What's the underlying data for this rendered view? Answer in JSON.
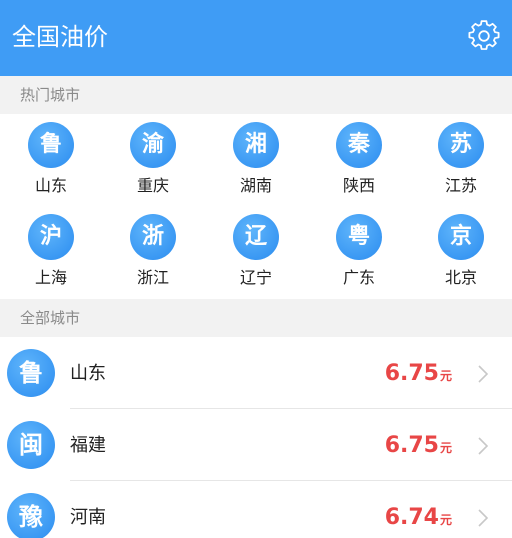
{
  "header": {
    "title": "全国油价",
    "settings_icon": "gear-icon"
  },
  "hot": {
    "label": "热门城市",
    "items": [
      {
        "badge": "鲁",
        "name": "山东"
      },
      {
        "badge": "渝",
        "name": "重庆"
      },
      {
        "badge": "湘",
        "name": "湖南"
      },
      {
        "badge": "秦",
        "name": "陕西"
      },
      {
        "badge": "苏",
        "name": "江苏"
      },
      {
        "badge": "沪",
        "name": "上海"
      },
      {
        "badge": "浙",
        "name": "浙江"
      },
      {
        "badge": "辽",
        "name": "辽宁"
      },
      {
        "badge": "粤",
        "name": "广东"
      },
      {
        "badge": "京",
        "name": "北京"
      }
    ]
  },
  "all": {
    "label": "全部城市",
    "items": [
      {
        "badge": "鲁",
        "name": "山东",
        "price": "6.75",
        "unit": "元"
      },
      {
        "badge": "闽",
        "name": "福建",
        "price": "6.75",
        "unit": "元"
      },
      {
        "badge": "豫",
        "name": "河南",
        "price": "6.74",
        "unit": "元"
      }
    ]
  },
  "colors": {
    "header_bg": "#3f9cf5",
    "badge": "#3a98f3",
    "price": "#e84646"
  }
}
